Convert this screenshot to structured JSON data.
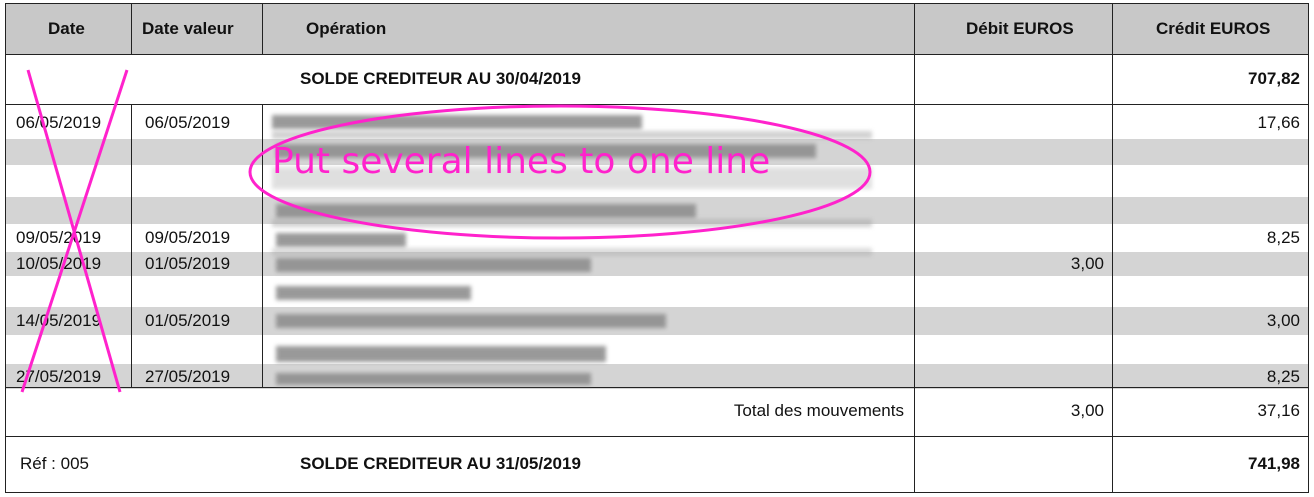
{
  "headers": {
    "date": "Date",
    "date_valeur": "Date valeur",
    "operation": "Opération",
    "debit": "Débit EUROS",
    "credit": "Crédit EUROS"
  },
  "opening": {
    "label": "SOLDE CREDITEUR AU 30/04/2019",
    "credit": "707,82"
  },
  "rows": [
    {
      "date": "06/05/2019",
      "date_valeur": "06/05/2019",
      "debit": "",
      "credit": "17,66"
    },
    {
      "date": "09/05/2019",
      "date_valeur": "09/05/2019",
      "debit": "",
      "credit": "8,25"
    },
    {
      "date": "10/05/2019",
      "date_valeur": "01/05/2019",
      "debit": "3,00",
      "credit": ""
    },
    {
      "date": "14/05/2019",
      "date_valeur": "01/05/2019",
      "debit": "",
      "credit": "3,00"
    },
    {
      "date": "27/05/2019",
      "date_valeur": "27/05/2019",
      "debit": "",
      "credit": "8,25"
    }
  ],
  "total": {
    "label": "Total des mouvements",
    "debit": "3,00",
    "credit": "37,16"
  },
  "closing": {
    "ref": "Réf : 005",
    "label": "SOLDE CREDITEUR AU 31/05/2019",
    "credit": "741,98"
  },
  "annotation": {
    "text": "Put several lines to one line",
    "color": "#ff22cc"
  }
}
